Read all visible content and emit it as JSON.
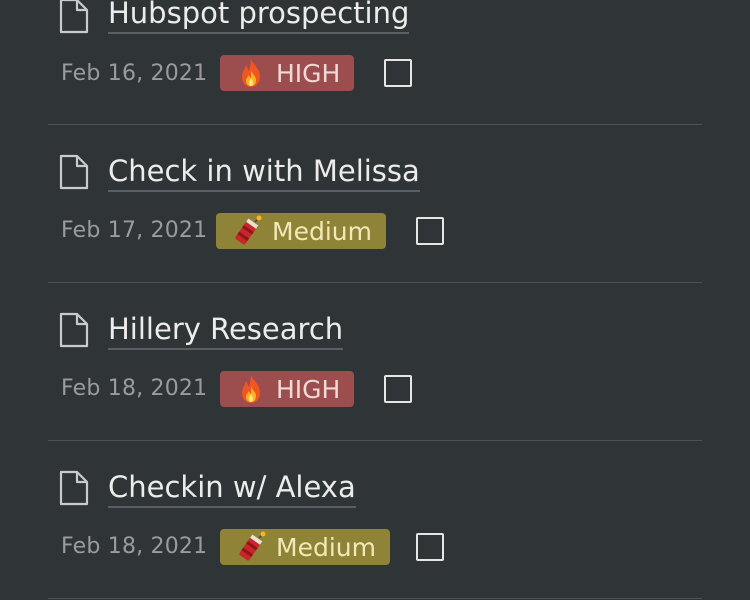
{
  "tasks": [
    {
      "title": "Hubspot prospecting",
      "date": "Feb 16, 2021",
      "priority": "HIGH",
      "priority_icon": "fire-icon",
      "checked": false
    },
    {
      "title": "Check in with Melissa",
      "date": "Feb 17, 2021",
      "priority": "Medium",
      "priority_icon": "firecracker-icon",
      "checked": false
    },
    {
      "title": "Hillery Research",
      "date": "Feb 18, 2021",
      "priority": "HIGH",
      "priority_icon": "fire-icon",
      "checked": false
    },
    {
      "title": "Checkin w/ Alexa",
      "date": "Feb 18, 2021",
      "priority": "Medium",
      "priority_icon": "firecracker-icon",
      "checked": false
    }
  ],
  "colors": {
    "background": "#2f3437",
    "high_badge": "#9c4d4d",
    "medium_badge": "#8f8338",
    "title_text": "#ececeb",
    "date_text": "#9a9b9c"
  }
}
